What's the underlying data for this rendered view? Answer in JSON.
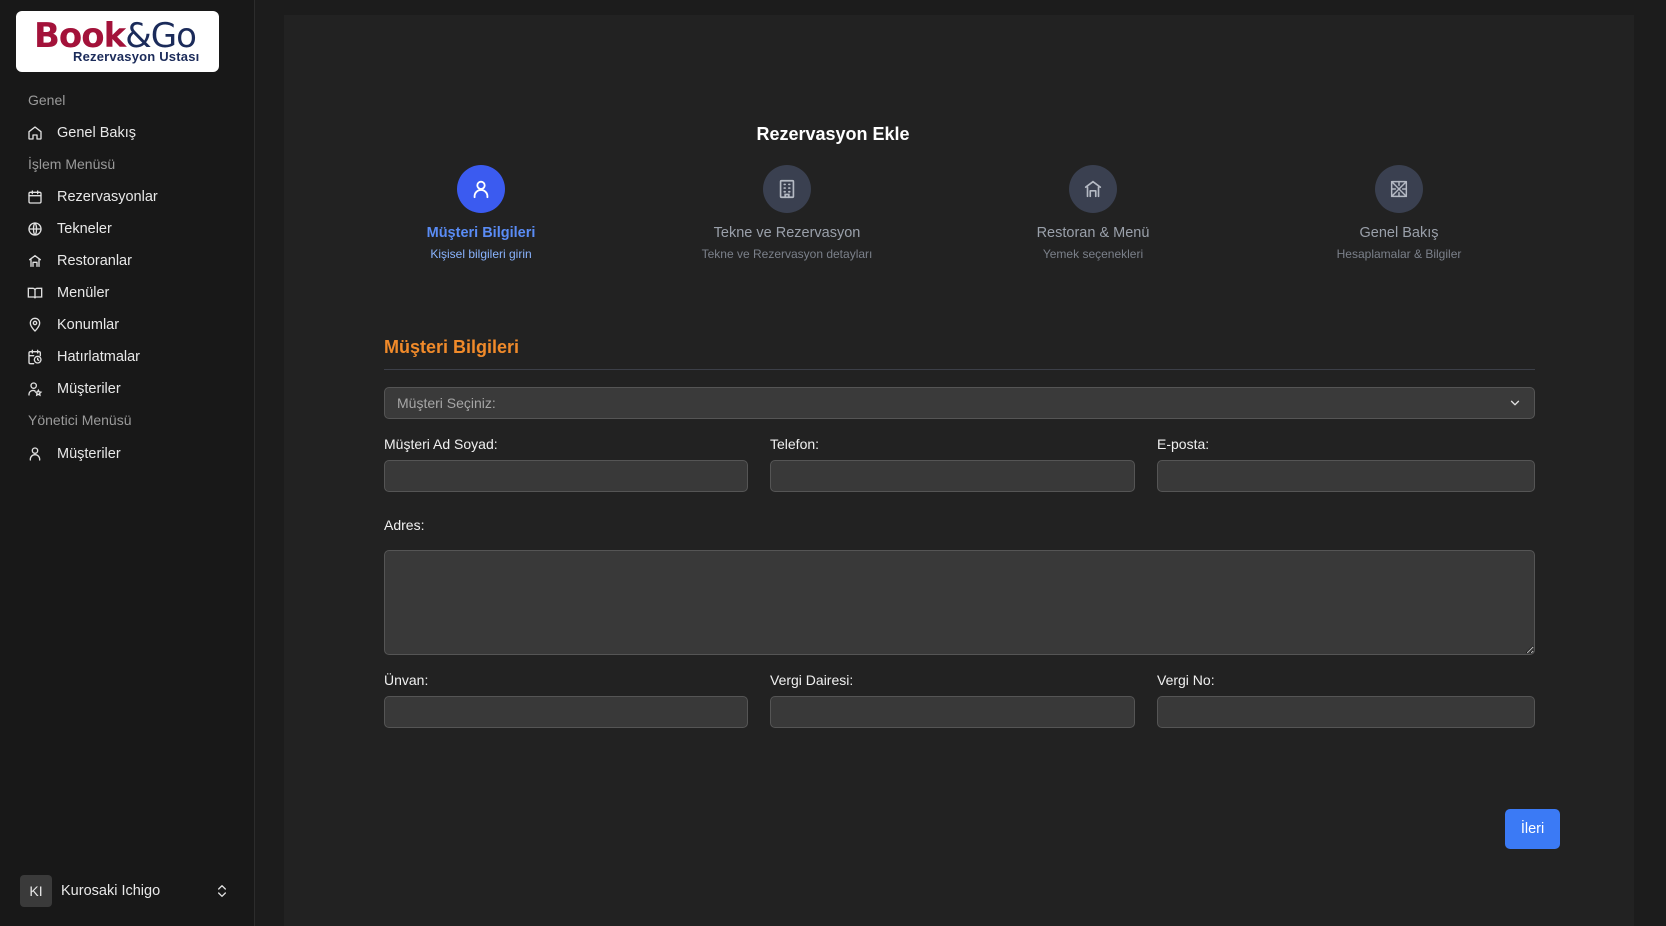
{
  "logo": {
    "book": "Book",
    "amp_go": "&Go",
    "tagline": "Rezervasyon Ustası"
  },
  "sidebar": {
    "sections": [
      {
        "title": "Genel",
        "items": [
          {
            "label": "Genel Bakış",
            "icon": "home-icon"
          }
        ]
      },
      {
        "title": "İşlem Menüsü",
        "items": [
          {
            "label": "Rezervasyonlar",
            "icon": "calendar-icon"
          },
          {
            "label": "Tekneler",
            "icon": "ship-icon"
          },
          {
            "label": "Restoranlar",
            "icon": "restaurant-icon"
          },
          {
            "label": "Menüler",
            "icon": "book-open-icon"
          },
          {
            "label": "Konumlar",
            "icon": "map-pin-icon"
          },
          {
            "label": "Hatırlatmalar",
            "icon": "calendar-clock-icon"
          },
          {
            "label": "Müşteriler",
            "icon": "user-star-icon"
          }
        ]
      },
      {
        "title": "Yönetici Menüsü",
        "items": [
          {
            "label": "Müşteriler",
            "icon": "user-icon"
          }
        ]
      }
    ],
    "user": {
      "initials": "KI",
      "name": "Kurosaki Ichigo"
    }
  },
  "main": {
    "title": "Rezervasyon Ekle",
    "steps": [
      {
        "title": "Müşteri Bilgileri",
        "subtitle": "Kişisel bilgileri girin",
        "icon": "user-icon",
        "active": true
      },
      {
        "title": "Tekne ve Rezervasyon",
        "subtitle": "Tekne ve Rezervasyon detayları",
        "icon": "building-icon",
        "active": false
      },
      {
        "title": "Restoran & Menü",
        "subtitle": "Yemek seçenekleri",
        "icon": "restaurant-icon",
        "active": false
      },
      {
        "title": "Genel Bakış",
        "subtitle": "Hesaplamalar & Bilgiler",
        "icon": "grid-icon",
        "active": false
      }
    ],
    "form": {
      "heading": "Müşteri Bilgileri",
      "customer_select_placeholder": "Müşteri Seçiniz:",
      "labels": {
        "name": "Müşteri Ad Soyad:",
        "phone": "Telefon:",
        "email": "E-posta:",
        "address": "Adres:",
        "title": "Ünvan:",
        "tax_office": "Vergi Dairesi:",
        "tax_no": "Vergi No:"
      },
      "values": {
        "name": "",
        "phone": "",
        "email": "",
        "address": "",
        "title": "",
        "tax_office": "",
        "tax_no": ""
      },
      "next_label": "İleri"
    },
    "colors": {
      "accent": "#3b5bf0",
      "heading": "#f08a2a",
      "button": "#3b7af5"
    }
  }
}
